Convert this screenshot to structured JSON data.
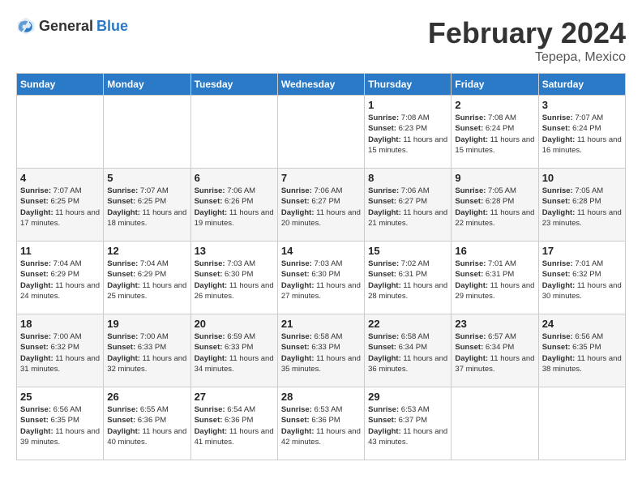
{
  "header": {
    "logo_general": "General",
    "logo_blue": "Blue",
    "month_year": "February 2024",
    "location": "Tepepa, Mexico"
  },
  "days_of_week": [
    "Sunday",
    "Monday",
    "Tuesday",
    "Wednesday",
    "Thursday",
    "Friday",
    "Saturday"
  ],
  "weeks": [
    [
      {
        "day": "",
        "sunrise": "",
        "sunset": "",
        "daylight": ""
      },
      {
        "day": "",
        "sunrise": "",
        "sunset": "",
        "daylight": ""
      },
      {
        "day": "",
        "sunrise": "",
        "sunset": "",
        "daylight": ""
      },
      {
        "day": "",
        "sunrise": "",
        "sunset": "",
        "daylight": ""
      },
      {
        "day": "1",
        "sunrise": "7:08 AM",
        "sunset": "6:23 PM",
        "daylight": "11 hours and 15 minutes."
      },
      {
        "day": "2",
        "sunrise": "7:08 AM",
        "sunset": "6:24 PM",
        "daylight": "11 hours and 15 minutes."
      },
      {
        "day": "3",
        "sunrise": "7:07 AM",
        "sunset": "6:24 PM",
        "daylight": "11 hours and 16 minutes."
      }
    ],
    [
      {
        "day": "4",
        "sunrise": "7:07 AM",
        "sunset": "6:25 PM",
        "daylight": "11 hours and 17 minutes."
      },
      {
        "day": "5",
        "sunrise": "7:07 AM",
        "sunset": "6:25 PM",
        "daylight": "11 hours and 18 minutes."
      },
      {
        "day": "6",
        "sunrise": "7:06 AM",
        "sunset": "6:26 PM",
        "daylight": "11 hours and 19 minutes."
      },
      {
        "day": "7",
        "sunrise": "7:06 AM",
        "sunset": "6:27 PM",
        "daylight": "11 hours and 20 minutes."
      },
      {
        "day": "8",
        "sunrise": "7:06 AM",
        "sunset": "6:27 PM",
        "daylight": "11 hours and 21 minutes."
      },
      {
        "day": "9",
        "sunrise": "7:05 AM",
        "sunset": "6:28 PM",
        "daylight": "11 hours and 22 minutes."
      },
      {
        "day": "10",
        "sunrise": "7:05 AM",
        "sunset": "6:28 PM",
        "daylight": "11 hours and 23 minutes."
      }
    ],
    [
      {
        "day": "11",
        "sunrise": "7:04 AM",
        "sunset": "6:29 PM",
        "daylight": "11 hours and 24 minutes."
      },
      {
        "day": "12",
        "sunrise": "7:04 AM",
        "sunset": "6:29 PM",
        "daylight": "11 hours and 25 minutes."
      },
      {
        "day": "13",
        "sunrise": "7:03 AM",
        "sunset": "6:30 PM",
        "daylight": "11 hours and 26 minutes."
      },
      {
        "day": "14",
        "sunrise": "7:03 AM",
        "sunset": "6:30 PM",
        "daylight": "11 hours and 27 minutes."
      },
      {
        "day": "15",
        "sunrise": "7:02 AM",
        "sunset": "6:31 PM",
        "daylight": "11 hours and 28 minutes."
      },
      {
        "day": "16",
        "sunrise": "7:01 AM",
        "sunset": "6:31 PM",
        "daylight": "11 hours and 29 minutes."
      },
      {
        "day": "17",
        "sunrise": "7:01 AM",
        "sunset": "6:32 PM",
        "daylight": "11 hours and 30 minutes."
      }
    ],
    [
      {
        "day": "18",
        "sunrise": "7:00 AM",
        "sunset": "6:32 PM",
        "daylight": "11 hours and 31 minutes."
      },
      {
        "day": "19",
        "sunrise": "7:00 AM",
        "sunset": "6:33 PM",
        "daylight": "11 hours and 32 minutes."
      },
      {
        "day": "20",
        "sunrise": "6:59 AM",
        "sunset": "6:33 PM",
        "daylight": "11 hours and 34 minutes."
      },
      {
        "day": "21",
        "sunrise": "6:58 AM",
        "sunset": "6:33 PM",
        "daylight": "11 hours and 35 minutes."
      },
      {
        "day": "22",
        "sunrise": "6:58 AM",
        "sunset": "6:34 PM",
        "daylight": "11 hours and 36 minutes."
      },
      {
        "day": "23",
        "sunrise": "6:57 AM",
        "sunset": "6:34 PM",
        "daylight": "11 hours and 37 minutes."
      },
      {
        "day": "24",
        "sunrise": "6:56 AM",
        "sunset": "6:35 PM",
        "daylight": "11 hours and 38 minutes."
      }
    ],
    [
      {
        "day": "25",
        "sunrise": "6:56 AM",
        "sunset": "6:35 PM",
        "daylight": "11 hours and 39 minutes."
      },
      {
        "day": "26",
        "sunrise": "6:55 AM",
        "sunset": "6:36 PM",
        "daylight": "11 hours and 40 minutes."
      },
      {
        "day": "27",
        "sunrise": "6:54 AM",
        "sunset": "6:36 PM",
        "daylight": "11 hours and 41 minutes."
      },
      {
        "day": "28",
        "sunrise": "6:53 AM",
        "sunset": "6:36 PM",
        "daylight": "11 hours and 42 minutes."
      },
      {
        "day": "29",
        "sunrise": "6:53 AM",
        "sunset": "6:37 PM",
        "daylight": "11 hours and 43 minutes."
      },
      {
        "day": "",
        "sunrise": "",
        "sunset": "",
        "daylight": ""
      },
      {
        "day": "",
        "sunrise": "",
        "sunset": "",
        "daylight": ""
      }
    ]
  ],
  "labels": {
    "sunrise": "Sunrise:",
    "sunset": "Sunset:",
    "daylight": "Daylight:"
  }
}
